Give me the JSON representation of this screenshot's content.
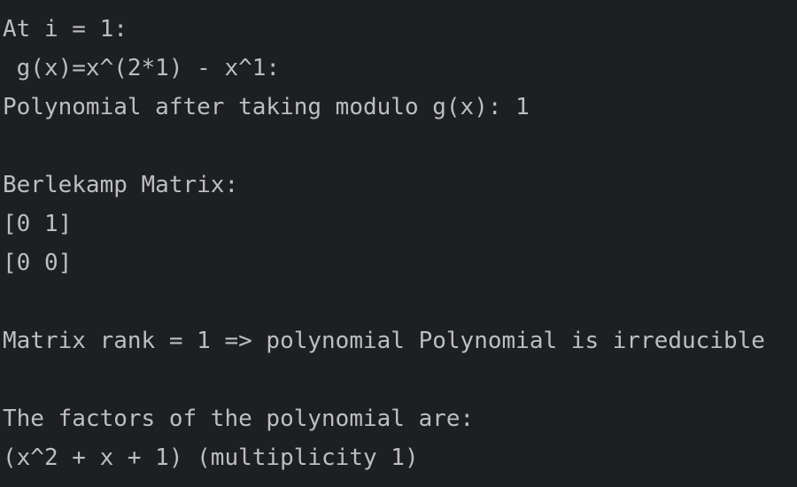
{
  "console": {
    "lines": [
      "At i = 1:",
      " g(x)=x^(2*1) - x^1:",
      "Polynomial after taking modulo g(x): 1",
      "",
      "Berlekamp Matrix:",
      "[0 1]",
      "[0 0]",
      "",
      "Matrix rank = 1 => polynomial Polynomial is irreducible",
      "",
      "The factors of the polynomial are:",
      "(x^2 + x + 1) (multiplicity 1)"
    ]
  },
  "colors": {
    "background": "#1e1f22",
    "text": "#bcbec4"
  }
}
